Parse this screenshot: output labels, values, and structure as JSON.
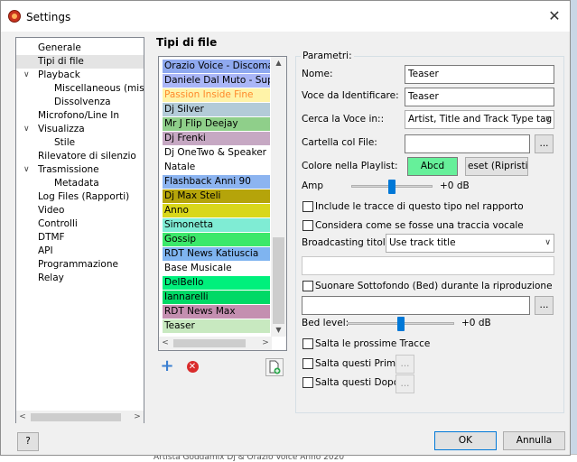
{
  "window": {
    "title": "Settings",
    "close": "✕"
  },
  "tree": {
    "items": [
      {
        "label": "Generale",
        "indent": 0,
        "expander": "",
        "selected": false
      },
      {
        "label": "Tipi di file",
        "indent": 0,
        "expander": "",
        "selected": true
      },
      {
        "label": "Playback",
        "indent": 0,
        "expander": "∨",
        "selected": false
      },
      {
        "label": "Miscellaneous (miscela",
        "indent": 1,
        "expander": "",
        "selected": false
      },
      {
        "label": "Dissolvenza",
        "indent": 1,
        "expander": "",
        "selected": false
      },
      {
        "label": "Microfono/Line In",
        "indent": 0,
        "expander": "",
        "selected": false
      },
      {
        "label": "Visualizza",
        "indent": 0,
        "expander": "∨",
        "selected": false
      },
      {
        "label": "Stile",
        "indent": 1,
        "expander": "",
        "selected": false
      },
      {
        "label": "Rilevatore di silenzio",
        "indent": 0,
        "expander": "",
        "selected": false
      },
      {
        "label": "Trasmissione",
        "indent": 0,
        "expander": "∨",
        "selected": false
      },
      {
        "label": "Metadata",
        "indent": 1,
        "expander": "",
        "selected": false
      },
      {
        "label": "Log Files (Rapporti)",
        "indent": 0,
        "expander": "",
        "selected": false
      },
      {
        "label": "Video",
        "indent": 0,
        "expander": "",
        "selected": false
      },
      {
        "label": "Controlli",
        "indent": 0,
        "expander": "",
        "selected": false
      },
      {
        "label": "DTMF",
        "indent": 0,
        "expander": "",
        "selected": false
      },
      {
        "label": "API",
        "indent": 0,
        "expander": "",
        "selected": false
      },
      {
        "label": "Programmazione",
        "indent": 0,
        "expander": "",
        "selected": false
      },
      {
        "label": "Relay",
        "indent": 0,
        "expander": "",
        "selected": false
      }
    ]
  },
  "file_types": {
    "heading": "Tipi di file",
    "rows": [
      {
        "label": "Orazio Voice - Discomania",
        "bg": "#8fa9ef",
        "fg": "#000000"
      },
      {
        "label": "Daniele Dal Muto - Super...",
        "bg": "#aab6f7",
        "fg": "#000000"
      },
      {
        "label": "Passion Inside Fine",
        "bg": "#fff3a8",
        "fg": "#ff8a2b"
      },
      {
        "label": "Dj Silver",
        "bg": "#b3cbd8",
        "fg": "#000000"
      },
      {
        "label": "Mr J Flip Deejay",
        "bg": "#8fcf8a",
        "fg": "#000000"
      },
      {
        "label": "Dj Frenki",
        "bg": "#c6a8c3",
        "fg": "#000000"
      },
      {
        "label": "Dj OneTwo & Speaker Oc...",
        "bg": "#ffffff",
        "fg": "#000000"
      },
      {
        "label": "Natale",
        "bg": "#ffffff",
        "fg": "#000000"
      },
      {
        "label": "Flashback Anni 90",
        "bg": "#8cb4f0",
        "fg": "#000000"
      },
      {
        "label": "Dj Max Steli",
        "bg": "#b5a40a",
        "fg": "#000000"
      },
      {
        "label": "Anno",
        "bg": "#d9d71a",
        "fg": "#000000"
      },
      {
        "label": "Simonetta",
        "bg": "#7fecd4",
        "fg": "#000000"
      },
      {
        "label": "Gossip",
        "bg": "#3ce86a",
        "fg": "#000000"
      },
      {
        "label": "RDT News Katiuscia",
        "bg": "#7fb4f0",
        "fg": "#000000"
      },
      {
        "label": "Base Musicale",
        "bg": "#ffffff",
        "fg": "#000000"
      },
      {
        "label": "DelBello",
        "bg": "#00f07c",
        "fg": "#000000"
      },
      {
        "label": "Iannarelli",
        "bg": "#00d966",
        "fg": "#000000"
      },
      {
        "label": "RDT News Max",
        "bg": "#c48fb0",
        "fg": "#000000"
      },
      {
        "label": "Teaser",
        "bg": "#c8e9c0",
        "fg": "#000000"
      }
    ]
  },
  "params": {
    "legend": "Parametri:",
    "name_label": "Nome:",
    "name_value": "Teaser",
    "voice_label": "Voce da Identificare:",
    "voice_value": "Teaser",
    "search_label": "Cerca la Voce in::",
    "search_value": "Artist, Title and Track Type tag",
    "folder_label": "Cartella col File:",
    "folder_value": "",
    "browse": "...",
    "color_label": "Colore nella Playlist:",
    "color_sample": "Abcd",
    "color_swatch": "#66f09a",
    "reset_label": "eset (Ripristina",
    "amp_label": "Amp",
    "amp_value": "+0 dB",
    "amp_level_fraction": 0.5,
    "include_label": "Include le tracce di questo tipo nel rapporto",
    "consider_label": "Considera come se fosse una traccia vocale",
    "broadcast_label": "Broadcasting titolo:",
    "broadcast_value": "Use track title",
    "broadcast_text": "",
    "bed_label": "Suonare Sottofondo (Bed) durante la riproduzione",
    "bed_file": "",
    "bed_level_label": "Bed level:",
    "bed_level_value": "+0 dB",
    "bed_level_fraction": 0.5,
    "skip_next_label": "Salta le prossime Tracce",
    "skip_before_label": "Salta questi Prima",
    "skip_after_label": "Salta questi Dopo"
  },
  "footer": {
    "help": "?",
    "ok": "OK",
    "cancel": "Annulla"
  },
  "background": {
    "bottom_text": "Artista  Goddamix Dj & Orazio Voice                               Anno  2020"
  }
}
